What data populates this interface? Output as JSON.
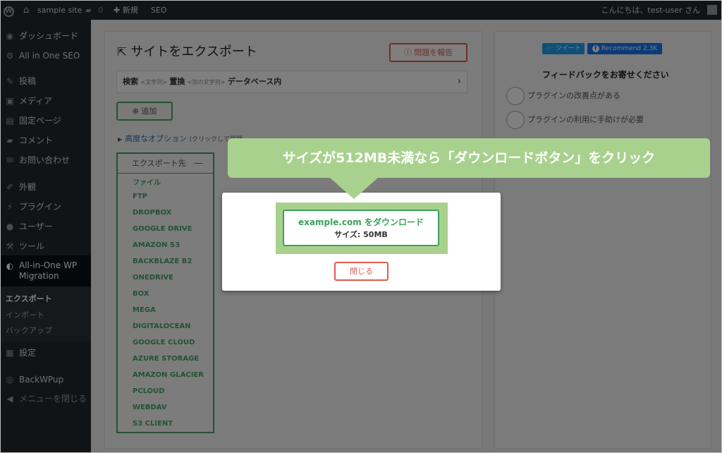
{
  "admin_bar": {
    "wp_logo": "W",
    "site_name": "sample site",
    "comment_count": "0",
    "new_label": "新規",
    "seo_label": "SEO",
    "greeting": "こんにちは、test-user さん"
  },
  "sidebar": {
    "items": [
      {
        "icon": "dashboard-icon",
        "glyph": "◉",
        "label": "ダッシュボード"
      },
      {
        "icon": "seo-icon",
        "glyph": "⚙",
        "label": "All in One SEO"
      },
      {
        "icon": "pin-icon",
        "glyph": "✎",
        "label": "投稿"
      },
      {
        "icon": "media-icon",
        "glyph": "▣",
        "label": "メディア"
      },
      {
        "icon": "page-icon",
        "glyph": "▤",
        "label": "固定ページ"
      },
      {
        "icon": "comment-icon",
        "glyph": "▰",
        "label": "コメント"
      },
      {
        "icon": "mail-icon",
        "glyph": "✉",
        "label": "お問い合わせ"
      },
      {
        "icon": "appearance-icon",
        "glyph": "✐",
        "label": "外観"
      },
      {
        "icon": "plugin-icon",
        "glyph": "⚡",
        "label": "プラグイン"
      },
      {
        "icon": "user-icon",
        "glyph": "●",
        "label": "ユーザー"
      },
      {
        "icon": "tools-icon",
        "glyph": "⚒",
        "label": "ツール"
      },
      {
        "icon": "migration-icon",
        "glyph": "◐",
        "label": "All-in-One WP Migration"
      },
      {
        "icon": "settings-icon",
        "glyph": "▦",
        "label": "設定"
      },
      {
        "icon": "backwpup-icon",
        "glyph": "◎",
        "label": "BackWPup"
      },
      {
        "icon": "collapse-icon",
        "glyph": "◀",
        "label": "メニューを閉じる"
      }
    ],
    "submenu": [
      "エクスポート",
      "インポート",
      "バックアップ"
    ]
  },
  "main": {
    "title": "サイトをエクスポート",
    "report_button": "ⓘ 問題を報告",
    "search": {
      "find": "検索",
      "find_hint": "<文字列>",
      "replace": "置換",
      "replace_hint": "<別の文字列>",
      "scope": "データベース内"
    },
    "add_button": "⊕ 追加",
    "advanced_link": "高度なオプション",
    "advanced_hint": "(クリックして展開",
    "export_to": "エクスポート先",
    "export_targets": [
      "ファイル",
      "FTP",
      "DROPBOX",
      "GOOGLE DRIVE",
      "AMAZON S3",
      "BACKBLAZE B2",
      "ONEDRIVE",
      "BOX",
      "MEGA",
      "DIGITALOCEAN",
      "GOOGLE CLOUD",
      "AZURE STORAGE",
      "AMAZON GLACIER",
      "PCLOUD",
      "WEBDAV",
      "S3 CLIENT"
    ]
  },
  "right_panel": {
    "tweet": "ツイート",
    "recommend": "Recommend 2.3K",
    "feedback_title": "フィードバックをお寄せください",
    "options": [
      "プラグインの改善点がある",
      "プラグインの利用に手助けが必要"
    ]
  },
  "modal": {
    "download_label": "example.com をダウンロード",
    "size_label": "サイズ:",
    "size_value": "50MB",
    "close_button": "閉じる"
  },
  "callout": "サイズが512MB未満なら「ダウンロードボタン」をクリック",
  "colors": {
    "green": "#3aa05c",
    "callout": "#a9d18e",
    "red": "#e25a4e",
    "admin": "#23282d"
  }
}
